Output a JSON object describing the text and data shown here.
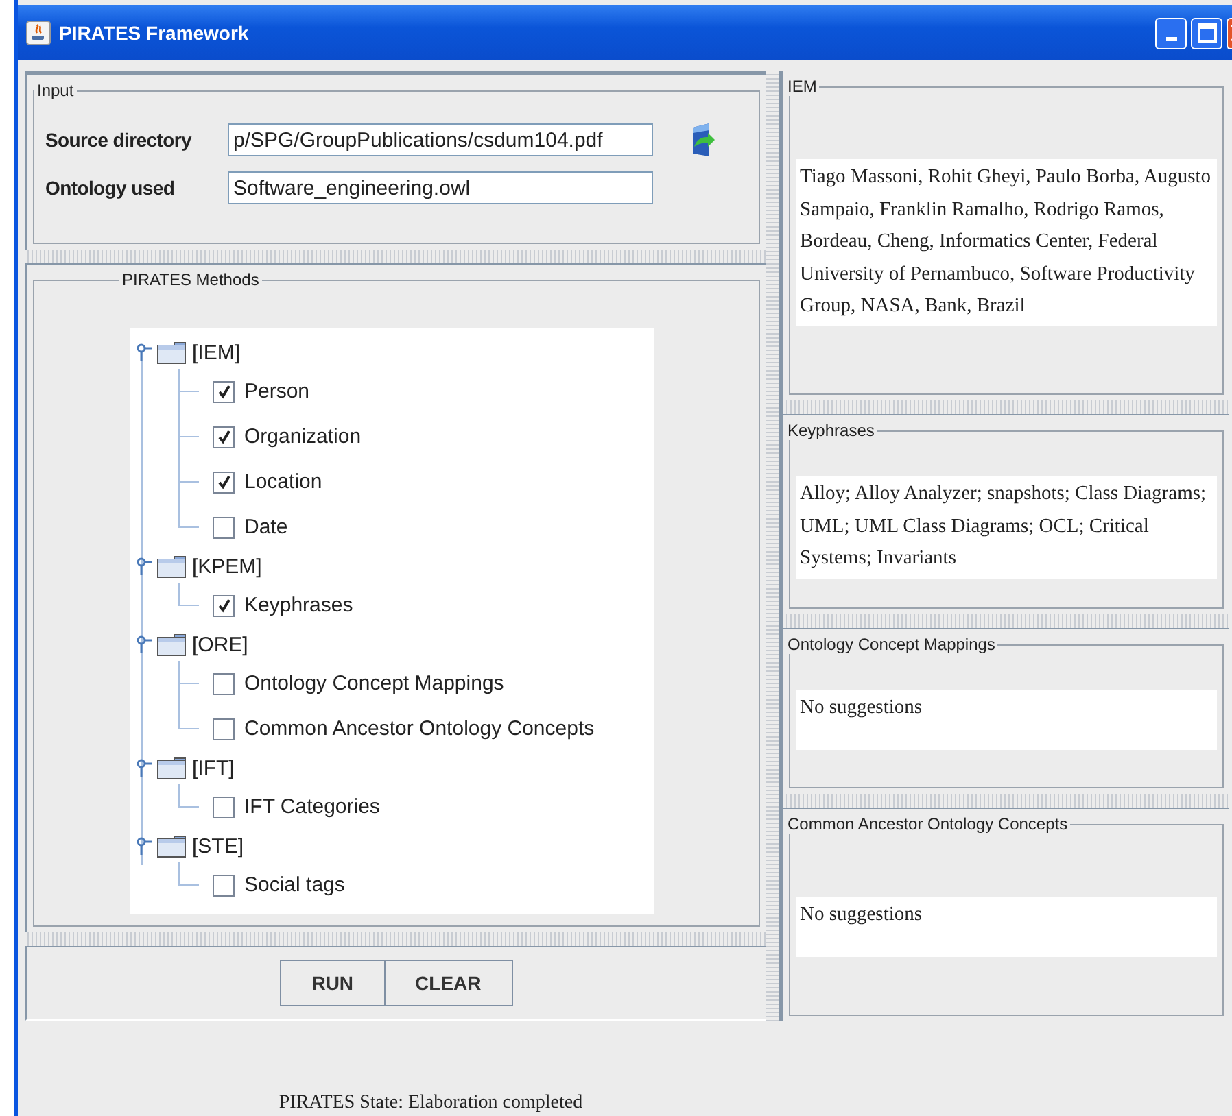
{
  "window": {
    "title": "PIRATES Framework"
  },
  "input": {
    "title": "Input",
    "fields": [
      {
        "label": "Source directory",
        "value": "p/SPG/GroupPublications/csdum104.pdf"
      },
      {
        "label": "Ontology used",
        "value": "Software_engineering.owl"
      }
    ]
  },
  "methods": {
    "title": "PIRATES Methods",
    "groups": [
      {
        "label": "[IEM]",
        "children": [
          {
            "label": "Person",
            "checked": true
          },
          {
            "label": "Organization",
            "checked": true
          },
          {
            "label": "Location",
            "checked": true
          },
          {
            "label": "Date",
            "checked": false
          }
        ]
      },
      {
        "label": "[KPEM]",
        "children": [
          {
            "label": "Keyphrases",
            "checked": true
          }
        ]
      },
      {
        "label": "[ORE]",
        "children": [
          {
            "label": "Ontology Concept Mappings",
            "checked": false
          },
          {
            "label": "Common Ancestor Ontology Concepts",
            "checked": false
          }
        ]
      },
      {
        "label": "[IFT]",
        "children": [
          {
            "label": "IFT Categories",
            "checked": false
          }
        ]
      },
      {
        "label": "[STE]",
        "children": [
          {
            "label": "Social tags",
            "checked": false
          }
        ]
      }
    ]
  },
  "buttons": [
    "RUN",
    "CLEAR"
  ],
  "results": [
    {
      "title": "IEM",
      "text": "Tiago Massoni,  Rohit Gheyi,  Paulo Borba,  Augusto Sampaio,  Franklin Ramalho,  Rodrigo Ramos,  Bordeau,  Cheng,  Informatics Center,  Federal University of Pernambuco,  Software Productivity Group,  NASA,  Bank,  Brazil"
    },
    {
      "title": "Keyphrases",
      "text": "Alloy;  Alloy Analyzer;  snapshots;  Class Diagrams;  UML;  UML Class Diagrams;  OCL;  Critical Systems;  Invariants"
    },
    {
      "title": "Ontology Concept Mappings",
      "text": "No suggestions"
    },
    {
      "title": "Common Ancestor Ontology Concepts",
      "text": "No suggestions"
    }
  ],
  "status": "PIRATES  State:  Elaboration completed"
}
